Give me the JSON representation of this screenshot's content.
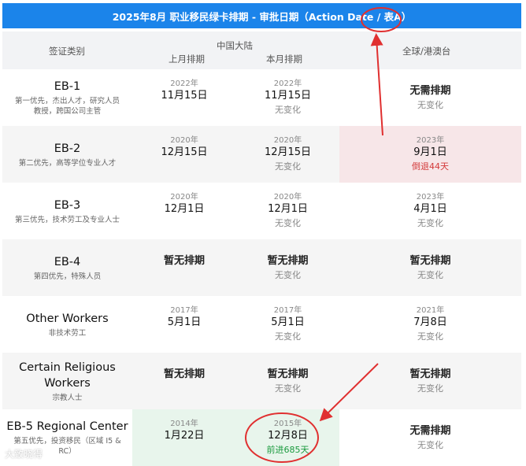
{
  "title": "2025年8月 职业移民绿卡排期 - 审批日期（Action Date / 表A）",
  "header": {
    "category": "签证类别",
    "china": "中国大陆",
    "last_month": "上月排期",
    "this_month": "本月排期",
    "global": "全球/港澳台"
  },
  "rows": [
    {
      "name": "EB-1",
      "desc": "第一优先，杰出人才，研究人员\n教授，跨国公司主管",
      "last": {
        "year": "2022年",
        "date": "11月15日"
      },
      "this": {
        "year": "2022年",
        "date": "11月15日",
        "change": "无变化"
      },
      "global": {
        "main": "无需排期",
        "change": "无变化"
      }
    },
    {
      "name": "EB-2",
      "desc": "第二优先，高等学位专业人才",
      "last": {
        "year": "2020年",
        "date": "12月15日"
      },
      "this": {
        "year": "2020年",
        "date": "12月15日",
        "change": "无变化"
      },
      "global": {
        "year": "2023年",
        "date": "9月1日",
        "change": "倒退44天"
      }
    },
    {
      "name": "EB-3",
      "desc": "第三优先，技术劳工及专业人士",
      "last": {
        "year": "2020年",
        "date": "12月1日"
      },
      "this": {
        "year": "2020年",
        "date": "12月1日",
        "change": "无变化"
      },
      "global": {
        "year": "2023年",
        "date": "4月1日",
        "change": "无变化"
      }
    },
    {
      "name": "EB-4",
      "desc": "第四优先，特殊人员",
      "last": {
        "main": "暂无排期"
      },
      "this": {
        "main": "暂无排期",
        "change": "无变化"
      },
      "global": {
        "main": "暂无排期",
        "change": "无变化"
      }
    },
    {
      "name": "Other Workers",
      "desc": "非技术劳工",
      "last": {
        "year": "2017年",
        "date": "5月1日"
      },
      "this": {
        "year": "2017年",
        "date": "5月1日",
        "change": "无变化"
      },
      "global": {
        "year": "2021年",
        "date": "7月8日",
        "change": "无变化"
      }
    },
    {
      "name": "Certain Religious\nWorkers",
      "desc": "宗教人士",
      "last": {
        "main": "暂无排期"
      },
      "this": {
        "main": "暂无排期",
        "change": "无变化"
      },
      "global": {
        "main": "暂无排期",
        "change": "无变化"
      }
    },
    {
      "name": "EB-5 Regional Center",
      "desc": "第五优先，投资移民（区域 I5 &\nRC）",
      "last": {
        "year": "2014年",
        "date": "1月22日"
      },
      "this": {
        "year": "2015年",
        "date": "12月8日",
        "change": "前进685天"
      },
      "global": {
        "main": "无需排期",
        "change": "无变化"
      }
    }
  ],
  "watermark": "大致晓得",
  "colors": {
    "title_bg": "#1b84ea",
    "annotation": "#e03030",
    "retreat": "#d33a3a",
    "advance": "#1a9a3e"
  }
}
